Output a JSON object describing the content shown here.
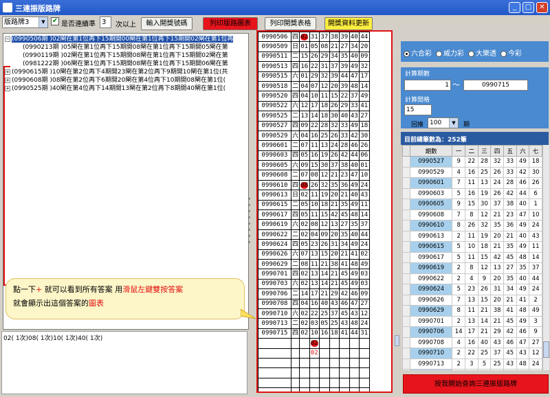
{
  "window": {
    "title": "三連振版路牌"
  },
  "toolbar": {
    "select_value": "版路牌3",
    "consecutive_label": "是否連續準",
    "times_value": "3",
    "times_suffix": "次以上",
    "btn_input": "輸入開獎號碼",
    "btn_print_chart": "列印版路圖表",
    "btn_print_table": "列印開獎表格",
    "btn_update": "開獎資料更新"
  },
  "tree": [
    {
      "label": "(0990506期 )02閘在第1位再下15期開00閘在第1位再下15期開02閘在第1位再",
      "expanded": true,
      "selected": true
    },
    {
      "label": "(0990213期 )05閘在第1位再下15期開08閘在第1位再下15期開05閘在第",
      "child": true
    },
    {
      "label": "(0990119期 )02閘在第1位再下15期開08閘在第1位再下15期開02閘在第",
      "child": true
    },
    {
      "label": "(0981222期 )06閘在第1位再下15期開08閘在第1位再下15期開06閘在第",
      "child": true
    },
    {
      "label": "(0990615期 )10閘在第2位再下4期開23閘在第2位再下9期開10閘在第1位(共",
      "expanded": false
    },
    {
      "label": "(0990608期 )08閘在第2位再下6期開20閘在第4位再下10期開08閘在第1位(",
      "expanded": false
    },
    {
      "label": "(0990525期 )40閘在第4位再下14期開13閘在第2位再下8期開40閘在第1位(",
      "expanded": false
    }
  ],
  "hint": {
    "part1": "點一下",
    "plus": "+",
    "part2": " 就可以看到所有答案 用",
    "red1": "滑鼠左鍵雙按答案",
    "part3": "就會顯示出這個答案的",
    "red2": "圖表"
  },
  "answer": "02( 1次)08( 1次)10( 1次)40( 1次)",
  "draws": [
    {
      "date": "0990506",
      "day": "四",
      "nums": [
        "02",
        "31",
        "37",
        "38",
        "39",
        "40",
        "44"
      ],
      "hl": 0
    },
    {
      "date": "0990509",
      "day": "日",
      "nums": [
        "01",
        "05",
        "08",
        "21",
        "27",
        "34",
        "20"
      ]
    },
    {
      "date": "0990511",
      "day": "二",
      "nums": [
        "15",
        "26",
        "29",
        "34",
        "35",
        "40",
        "09"
      ]
    },
    {
      "date": "0990513",
      "day": "四",
      "nums": [
        "16",
        "22",
        "31",
        "37",
        "39",
        "49",
        "32"
      ]
    },
    {
      "date": "0990515",
      "day": "六",
      "nums": [
        "01",
        "29",
        "32",
        "39",
        "44",
        "47",
        "17"
      ]
    },
    {
      "date": "0990518",
      "day": "二",
      "nums": [
        "04",
        "07",
        "12",
        "20",
        "39",
        "48",
        "14"
      ]
    },
    {
      "date": "0990520",
      "day": "四",
      "nums": [
        "04",
        "10",
        "11",
        "15",
        "22",
        "37",
        "49"
      ]
    },
    {
      "date": "0990522",
      "day": "六",
      "nums": [
        "12",
        "17",
        "18",
        "26",
        "29",
        "33",
        "41"
      ]
    },
    {
      "date": "0990525",
      "day": "二",
      "nums": [
        "13",
        "14",
        "18",
        "30",
        "40",
        "43",
        "27"
      ]
    },
    {
      "date": "0990527",
      "day": "四",
      "nums": [
        "09",
        "22",
        "28",
        "32",
        "33",
        "49",
        "18"
      ]
    },
    {
      "date": "0990529",
      "day": "六",
      "nums": [
        "04",
        "16",
        "25",
        "26",
        "33",
        "42",
        "30"
      ]
    },
    {
      "date": "0990601",
      "day": "二",
      "nums": [
        "07",
        "11",
        "13",
        "24",
        "28",
        "46",
        "26"
      ]
    },
    {
      "date": "0990603",
      "day": "四",
      "nums": [
        "05",
        "16",
        "19",
        "26",
        "42",
        "44",
        "06"
      ]
    },
    {
      "date": "0990605",
      "day": "六",
      "nums": [
        "09",
        "15",
        "30",
        "37",
        "38",
        "40",
        "01"
      ]
    },
    {
      "date": "0990608",
      "day": "二",
      "nums": [
        "07",
        "08",
        "12",
        "21",
        "23",
        "47",
        "10"
      ]
    },
    {
      "date": "0990610",
      "day": "四",
      "nums": [
        "08",
        "26",
        "32",
        "35",
        "36",
        "49",
        "24"
      ],
      "hl": 0
    },
    {
      "date": "0990613",
      "day": "日",
      "nums": [
        "02",
        "11",
        "19",
        "20",
        "21",
        "40",
        "43"
      ]
    },
    {
      "date": "0990615",
      "day": "二",
      "nums": [
        "05",
        "10",
        "18",
        "21",
        "35",
        "49",
        "11"
      ]
    },
    {
      "date": "0990617",
      "day": "四",
      "nums": [
        "05",
        "11",
        "15",
        "42",
        "45",
        "48",
        "14"
      ]
    },
    {
      "date": "0990619",
      "day": "六",
      "nums": [
        "02",
        "08",
        "12",
        "13",
        "27",
        "35",
        "37"
      ]
    },
    {
      "date": "0990622",
      "day": "二",
      "nums": [
        "02",
        "04",
        "09",
        "20",
        "35",
        "40",
        "44"
      ]
    },
    {
      "date": "0990624",
      "day": "四",
      "nums": [
        "05",
        "23",
        "26",
        "31",
        "34",
        "49",
        "24"
      ]
    },
    {
      "date": "0990626",
      "day": "六",
      "nums": [
        "07",
        "13",
        "15",
        "20",
        "21",
        "41",
        "02"
      ]
    },
    {
      "date": "0990629",
      "day": "二",
      "nums": [
        "08",
        "11",
        "21",
        "38",
        "41",
        "48",
        "49"
      ]
    },
    {
      "date": "0990701",
      "day": "四",
      "nums": [
        "02",
        "13",
        "14",
        "21",
        "45",
        "49",
        "03"
      ]
    },
    {
      "date": "0990703",
      "day": "六",
      "nums": [
        "02",
        "13",
        "14",
        "21",
        "45",
        "49",
        "03"
      ]
    },
    {
      "date": "0990706",
      "day": "二",
      "nums": [
        "14",
        "17",
        "21",
        "29",
        "42",
        "46",
        "09"
      ]
    },
    {
      "date": "0990708",
      "day": "四",
      "nums": [
        "04",
        "16",
        "40",
        "43",
        "46",
        "47",
        "27"
      ]
    },
    {
      "date": "0990710",
      "day": "六",
      "nums": [
        "02",
        "22",
        "25",
        "37",
        "45",
        "43",
        "12"
      ]
    },
    {
      "date": "0990713",
      "day": "二",
      "nums": [
        "02",
        "03",
        "05",
        "25",
        "43",
        "48",
        "24"
      ]
    },
    {
      "date": "0990715",
      "day": "四",
      "nums": [
        "02",
        "10",
        "16",
        "18",
        "41",
        "44",
        "31"
      ]
    }
  ],
  "pred": {
    "hl": "02",
    "txt": "02"
  },
  "right": {
    "lotteries": [
      "六合彩",
      "威力彩",
      "大樂透",
      "今彩"
    ],
    "selected_lottery": 0,
    "period_label": "計算期數",
    "period_from": "1",
    "tilde": "〜",
    "period_to": "0990715",
    "interval_label": "計算間格",
    "interval_value": "15",
    "back_label": "回推",
    "back_value": "100",
    "back_suffix": "期",
    "total_label": "目前總筆數為：252筆",
    "headers": [
      "期數",
      "一",
      "二",
      "三",
      "四",
      "五",
      "六",
      "七"
    ],
    "rows": [
      [
        "0990527",
        "9",
        "22",
        "28",
        "32",
        "33",
        "49",
        "18"
      ],
      [
        "0990529",
        "4",
        "16",
        "25",
        "26",
        "33",
        "42",
        "30"
      ],
      [
        "0990601",
        "7",
        "11",
        "13",
        "24",
        "28",
        "46",
        "26"
      ],
      [
        "0990603",
        "5",
        "16",
        "19",
        "26",
        "42",
        "44",
        "6"
      ],
      [
        "0990605",
        "9",
        "15",
        "30",
        "37",
        "38",
        "40",
        "1"
      ],
      [
        "0990608",
        "7",
        "8",
        "12",
        "21",
        "23",
        "47",
        "10"
      ],
      [
        "0990610",
        "8",
        "26",
        "32",
        "35",
        "36",
        "49",
        "24"
      ],
      [
        "0990613",
        "2",
        "11",
        "19",
        "20",
        "21",
        "40",
        "43"
      ],
      [
        "0990615",
        "5",
        "10",
        "18",
        "21",
        "35",
        "49",
        "11"
      ],
      [
        "0990617",
        "5",
        "11",
        "15",
        "42",
        "45",
        "48",
        "14"
      ],
      [
        "0990619",
        "2",
        "8",
        "12",
        "13",
        "27",
        "35",
        "37"
      ],
      [
        "0990622",
        "2",
        "4",
        "9",
        "20",
        "35",
        "40",
        "44"
      ],
      [
        "0990624",
        "5",
        "23",
        "26",
        "31",
        "34",
        "49",
        "24"
      ],
      [
        "0990626",
        "7",
        "13",
        "15",
        "20",
        "21",
        "41",
        "2"
      ],
      [
        "0990629",
        "8",
        "11",
        "21",
        "38",
        "41",
        "48",
        "49"
      ],
      [
        "0990701",
        "2",
        "13",
        "14",
        "21",
        "45",
        "49",
        "3"
      ],
      [
        "0990706",
        "14",
        "17",
        "21",
        "29",
        "42",
        "46",
        "9"
      ],
      [
        "0990708",
        "4",
        "16",
        "40",
        "43",
        "46",
        "47",
        "27"
      ],
      [
        "0990710",
        "2",
        "22",
        "25",
        "37",
        "45",
        "43",
        "12"
      ],
      [
        "0990713",
        "2",
        "3",
        "5",
        "25",
        "43",
        "48",
        "24"
      ],
      [
        "0990715",
        "2",
        "10",
        "16",
        "18",
        "41",
        "44",
        "31"
      ]
    ],
    "query_btn": "按我開始查詢三連振版路牌"
  }
}
